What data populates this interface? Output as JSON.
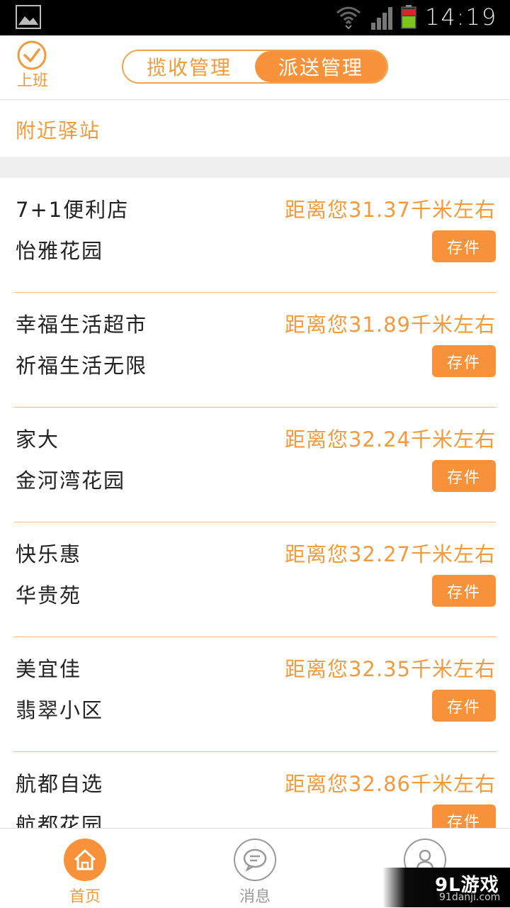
{
  "status_bar": {
    "time": "14:19",
    "icons": [
      "gallery-icon",
      "wifi-icon",
      "signal-icon",
      "battery-icon"
    ]
  },
  "header": {
    "checkin_label": "上班",
    "tabs": [
      {
        "label": "揽收管理",
        "active": false
      },
      {
        "label": "派送管理",
        "active": true
      }
    ]
  },
  "section": {
    "title": "附近驿站"
  },
  "stations": [
    {
      "name": "7+1便利店",
      "distance": "距离您31.37千米左右",
      "address": "怡雅花园",
      "action": "存件"
    },
    {
      "name": "幸福生活超市",
      "distance": "距离您31.89千米左右",
      "address": "祈福生活无限",
      "action": "存件"
    },
    {
      "name": "家大",
      "distance": "距离您32.24千米左右",
      "address": "金河湾花园",
      "action": "存件"
    },
    {
      "name": "快乐惠",
      "distance": "距离您32.27千米左右",
      "address": "华贵苑",
      "action": "存件"
    },
    {
      "name": "美宜佳",
      "distance": "距离您32.35千米左右",
      "address": "翡翠小区",
      "action": "存件"
    },
    {
      "name": "航都自选",
      "distance": "距离您32.86千米左右",
      "address": "航都花园",
      "action": "存件"
    }
  ],
  "bottom_nav": [
    {
      "label": "首页",
      "icon": "home-icon",
      "active": true
    },
    {
      "label": "消息",
      "icon": "message-icon",
      "active": false
    },
    {
      "label": "",
      "icon": "user-icon",
      "active": false
    }
  ],
  "watermark": {
    "text": "9L游戏",
    "sub": "91danji.com"
  },
  "colors": {
    "accent": "#f7923a",
    "accent_text": "#f39a3c",
    "divider": "#f3bb85"
  }
}
